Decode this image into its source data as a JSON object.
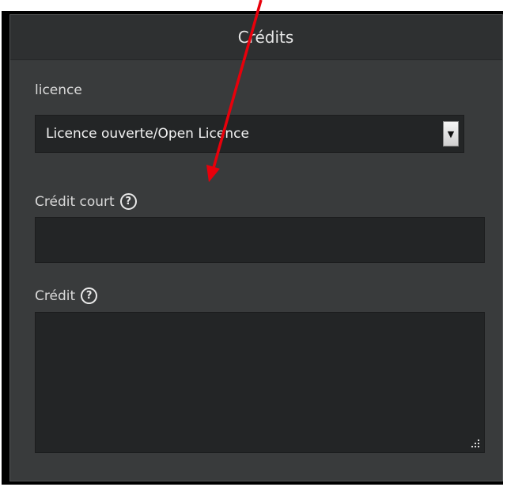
{
  "panel": {
    "title": "Crédits"
  },
  "licence_field": {
    "label": "licence",
    "selected_value": "Licence ouverte/Open Licence"
  },
  "short_credit_field": {
    "label": "Crédit court",
    "value": "",
    "help_symbol": "?"
  },
  "credit_field": {
    "label": "Crédit",
    "value": "",
    "help_symbol": "?"
  },
  "icons": {
    "select_arrow": "caret-down-icon",
    "help": "question-circle-icon",
    "resize": "resize-grip-icon",
    "annotation": "red-arrow-annotation"
  },
  "colors": {
    "panel_bg": "#393b3c",
    "header_bg": "#2e3031",
    "input_bg": "#232526",
    "annotation_arrow": "#e8000b"
  }
}
